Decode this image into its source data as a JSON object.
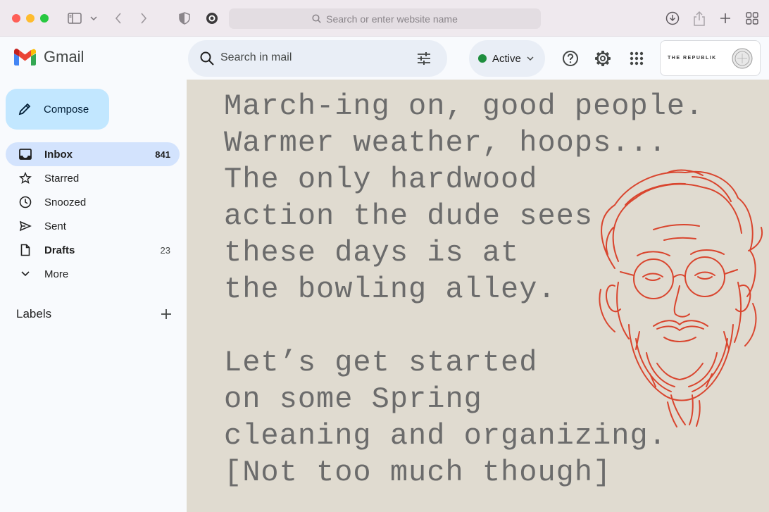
{
  "browser": {
    "url_placeholder": "Search or enter website name",
    "icons": [
      "sidebar-icon",
      "chevron-down-icon",
      "back-icon",
      "forward-icon",
      "shield-icon",
      "extension-icon",
      "download-icon",
      "share-icon",
      "new-tab-icon",
      "tab-overview-icon"
    ]
  },
  "header": {
    "app_name": "Gmail",
    "search_placeholder": "Search in mail",
    "status_label": "Active",
    "status_color": "#1e8e3e",
    "brand": "THE REPUBLIK"
  },
  "sidebar": {
    "compose_label": "Compose",
    "items": [
      {
        "label": "Inbox",
        "count": "841",
        "icon": "inbox-icon"
      },
      {
        "label": "Starred",
        "count": "",
        "icon": "star-icon"
      },
      {
        "label": "Snoozed",
        "count": "",
        "icon": "clock-icon"
      },
      {
        "label": "Sent",
        "count": "",
        "icon": "send-icon"
      },
      {
        "label": "Drafts",
        "count": "23",
        "icon": "draft-icon"
      },
      {
        "label": "More",
        "count": "",
        "icon": "chevron-down-icon"
      }
    ],
    "labels_heading": "Labels"
  },
  "message": {
    "text": "March-ing on, good people.\nWarmer weather, hoops...\nThe only hardwood\naction the dude sees\nthese days is at\nthe bowling alley.\n\nLet’s get started\non some Spring\ncleaning and organizing.\n[Not too much though]"
  },
  "colors": {
    "accent": "#c2e7ff",
    "selected": "#d3e3fd",
    "canvas": "#e0dbd0",
    "illustration": "#d9452e"
  }
}
